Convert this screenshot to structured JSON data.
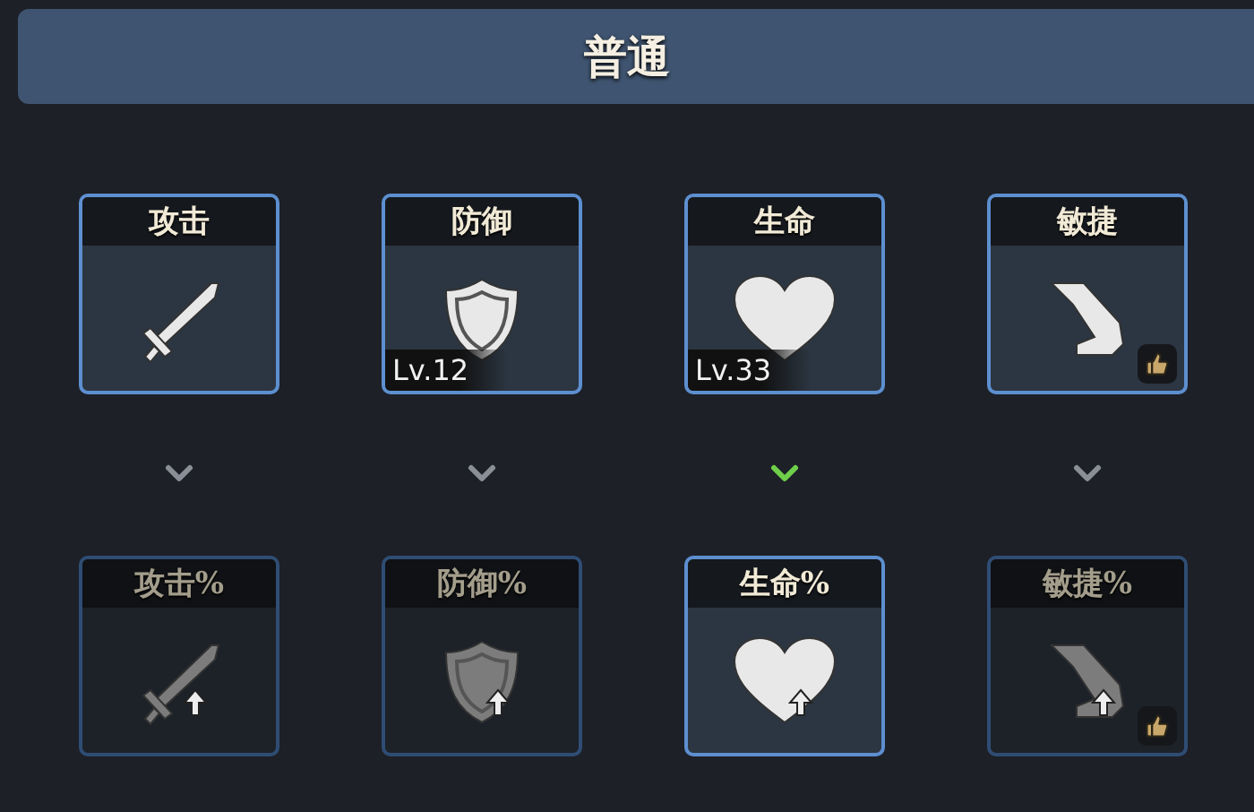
{
  "header": {
    "title": "普通"
  },
  "columns": [
    {
      "top": {
        "label": "攻击",
        "kind": "sword",
        "recommended": false
      },
      "link_active": false,
      "bottom": {
        "label": "攻击%",
        "kind": "sword",
        "unlocked": false,
        "recommended": false
      }
    },
    {
      "top": {
        "label": "防御",
        "kind": "shield",
        "level": "Lv.12",
        "recommended": false
      },
      "link_active": false,
      "bottom": {
        "label": "防御%",
        "kind": "shield",
        "unlocked": false,
        "recommended": false
      }
    },
    {
      "top": {
        "label": "生命",
        "kind": "heart",
        "level": "Lv.33",
        "recommended": false
      },
      "link_active": true,
      "bottom": {
        "label": "生命%",
        "kind": "heart",
        "unlocked": true,
        "recommended": false
      }
    },
    {
      "top": {
        "label": "敏捷",
        "kind": "boot",
        "recommended": true
      },
      "link_active": false,
      "bottom": {
        "label": "敏捷%",
        "kind": "boot",
        "unlocked": false,
        "recommended": true
      }
    }
  ]
}
